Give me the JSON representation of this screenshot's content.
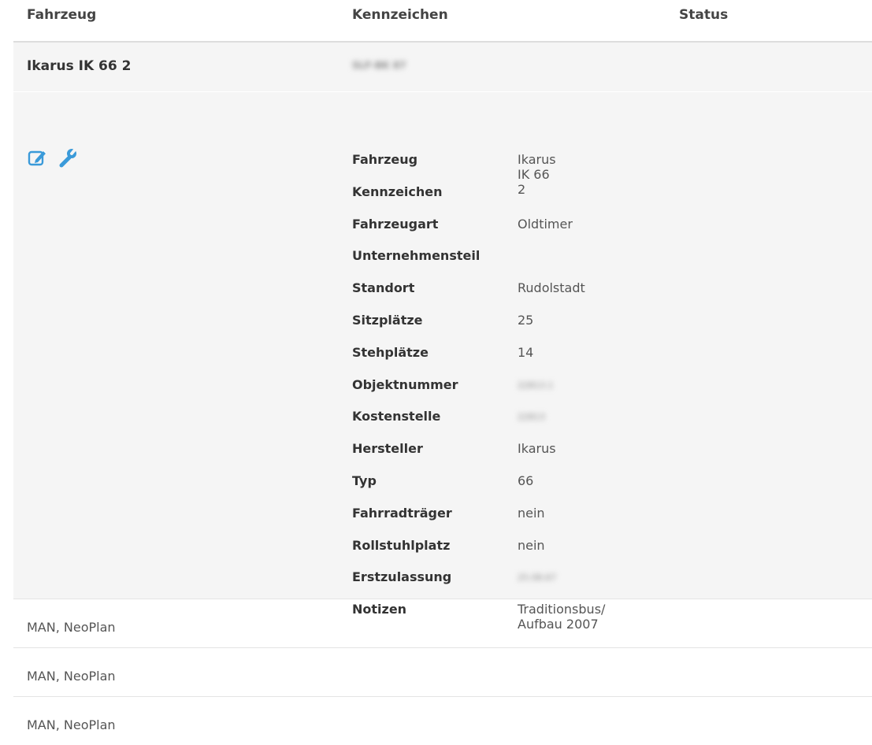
{
  "table": {
    "columns": {
      "vehicle": "Fahrzeug",
      "plate": "Kennzeichen",
      "status": "Status"
    }
  },
  "expanded_row": {
    "title": "Ikarus IK 66 2",
    "plate_redacted": "SLF-BK 87",
    "details": [
      {
        "key": "Fahrzeug",
        "value": "Ikarus IK 66 2",
        "redacted": false
      },
      {
        "key": "Kennzeichen",
        "value": "",
        "redacted": false
      },
      {
        "key": "Fahrzeugart",
        "value": "Oldtimer",
        "redacted": false
      },
      {
        "key": "Unternehmensteil",
        "value": "",
        "redacted": false
      },
      {
        "key": "Standort",
        "value": "Rudolstadt",
        "redacted": false
      },
      {
        "key": "Sitzplätze",
        "value": "25",
        "redacted": false
      },
      {
        "key": "Stehplätze",
        "value": "14",
        "redacted": false
      },
      {
        "key": "Objektnummer",
        "value": "22813.1",
        "redacted": true
      },
      {
        "key": "Kostenstelle",
        "value": "22813",
        "redacted": true
      },
      {
        "key": "Hersteller",
        "value": "Ikarus",
        "redacted": false
      },
      {
        "key": "Typ",
        "value": "66",
        "redacted": false
      },
      {
        "key": "Fahrradträger",
        "value": "nein",
        "redacted": false
      },
      {
        "key": "Rollstuhlplatz",
        "value": "nein",
        "redacted": false
      },
      {
        "key": "Erstzulassung",
        "value": "25.08.67",
        "redacted": true
      },
      {
        "key": "Notizen",
        "value": "Traditionsbus/ Aufbau 2007",
        "redacted": false
      }
    ],
    "actions": [
      {
        "name": "edit-icon",
        "color": "#3a9ad9"
      },
      {
        "name": "wrench-icon",
        "color": "#3a9ad9"
      }
    ]
  },
  "rows": [
    {
      "label": "MAN, NeoPlan"
    },
    {
      "label": "MAN, NeoPlan"
    },
    {
      "label": "MAN, NeoPlan"
    }
  ],
  "colors": {
    "accent": "#3a9ad9",
    "expanded_background": "#f5f5f5"
  }
}
